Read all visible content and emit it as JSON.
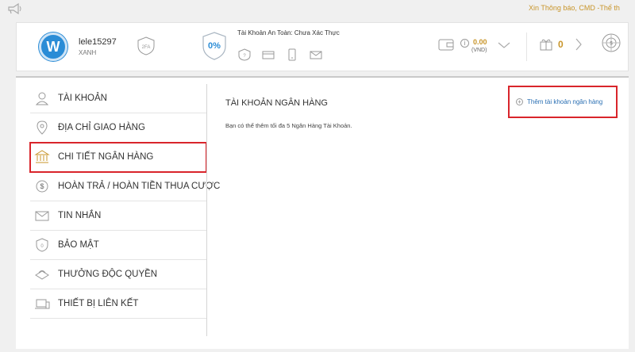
{
  "topbar": {
    "marquee": "Xin Thông báo, CMD  -Thể th"
  },
  "user": {
    "initial": "W",
    "name": "lele15297",
    "level": "XANH",
    "twofa": "2FA"
  },
  "security": {
    "percent": "0%",
    "label": "Tài Khoản An Toàn: Chưa Xác Thực"
  },
  "wallet": {
    "balance": "0.00",
    "currency": "(VND)"
  },
  "gift": {
    "count": "0"
  },
  "sidebar": {
    "items": [
      {
        "label": "TÀI KHOẢN",
        "icon": "user-icon"
      },
      {
        "label": "ĐỊA CHỈ GIAO HÀNG",
        "icon": "location-pin-icon"
      },
      {
        "label": "CHI TIẾT NGÂN HÀNG",
        "icon": "bank-icon",
        "active": true
      },
      {
        "label": "HOÀN TRẢ / HOÀN TIỀN THUA CƯỢC",
        "icon": "dollar-coin-icon"
      },
      {
        "label": "TIN NHẮN",
        "icon": "envelope-icon"
      },
      {
        "label": "BẢO MẬT",
        "icon": "shield-icon"
      },
      {
        "label": "THƯỞNG ĐỘC QUYỀN",
        "icon": "bonus-icon"
      },
      {
        "label": "THIẾT BỊ LIÊN KẾT",
        "icon": "devices-icon"
      }
    ]
  },
  "content": {
    "title": "TÀI KHOẢN NGÂN HÀNG",
    "note": "Bạn có thể thêm tối đa 5 Ngân Hàng Tài Khoản.",
    "add_button": "Thêm tài khoản ngân hàng"
  },
  "colors": {
    "accent": "#2a8cd6",
    "gold": "#c8952a",
    "highlight": "#d9252b",
    "link": "#2a6fb3"
  }
}
